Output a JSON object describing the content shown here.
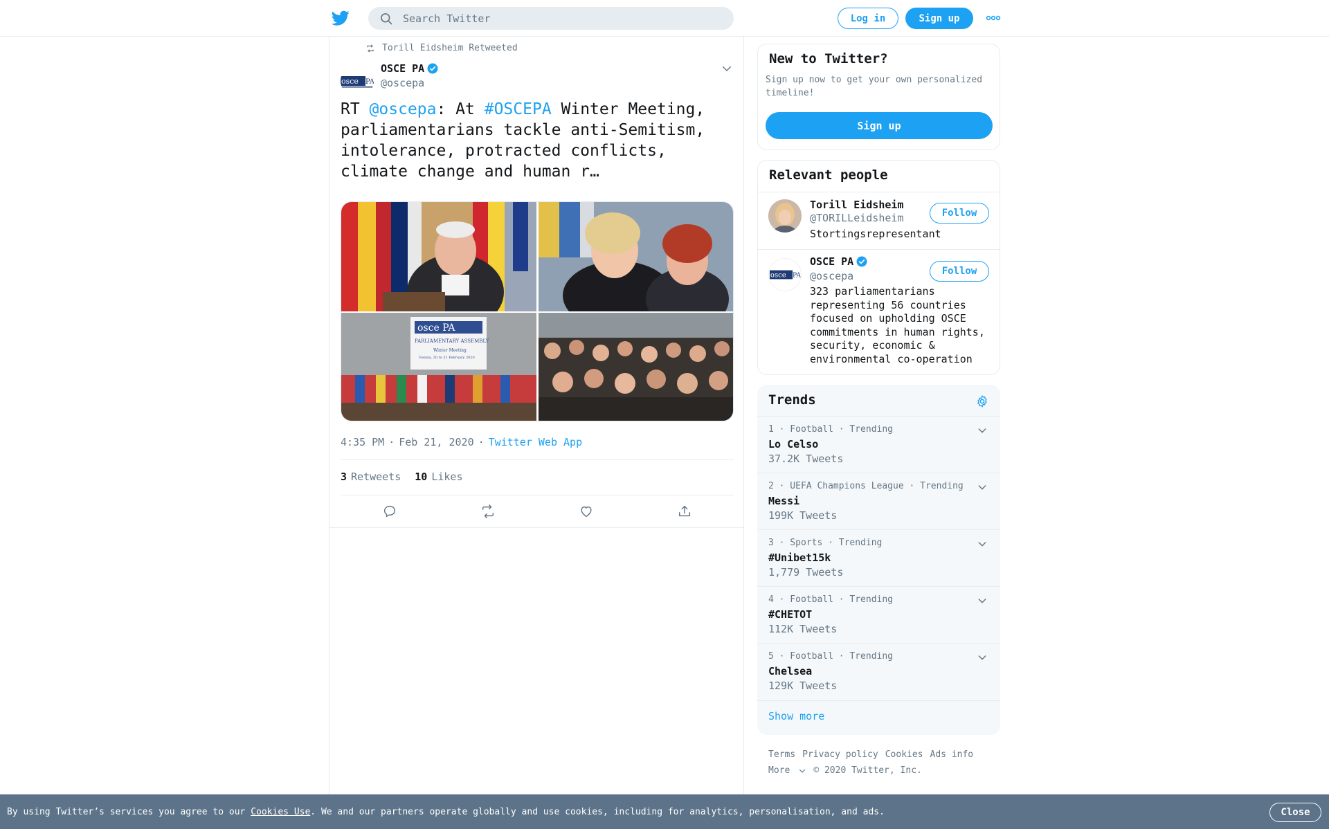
{
  "header": {
    "search_placeholder": "Search Twitter",
    "login_label": "Log in",
    "signup_label": "Sign up"
  },
  "tweet": {
    "retweeted_by": "Torill Eidsheim Retweeted",
    "author_name": "OSCE PA",
    "author_handle": "@oscepa",
    "text_prefix": "RT ",
    "mention": "@oscepa",
    "text_mid": ": At ",
    "hashtag": "#OSCEPA",
    "text_rest": " Winter Meeting, parliamentarians tackle anti-Semitism, intolerance, protracted conflicts, climate change and human r…",
    "time": "4:35 PM",
    "date": "Feb 21, 2020",
    "source": "Twitter Web App",
    "retweets_count": "3",
    "retweets_label": "Retweets",
    "likes_count": "10",
    "likes_label": "Likes",
    "media_text": {
      "banner_logo": "osce PA",
      "banner_title": "PARLIAMENTARY ASSEMBLY",
      "banner_line1": "Winter Meeting",
      "banner_line2": "Vienna, 20 to 21 February 2020"
    }
  },
  "new_to_twitter": {
    "title": "New to Twitter?",
    "subtitle": "Sign up now to get your own personalized timeline!",
    "button_label": "Sign up"
  },
  "relevant_people": {
    "title": "Relevant people",
    "people": [
      {
        "name": "Torill Eidsheim",
        "handle": "@TORILLeidsheim",
        "bio": "Stortingsrepresentant",
        "follow_label": "Follow"
      },
      {
        "name": "OSCE PA",
        "handle": "@oscepa",
        "bio": "323 parliamentarians representing 56 countries focused on upholding OSCE commitments in human rights, security, economic & environmental co-operation",
        "follow_label": "Follow"
      }
    ]
  },
  "trends": {
    "title": "Trends",
    "items": [
      {
        "meta": "1 · Football · Trending",
        "name": "Lo Celso",
        "count": "37.2K Tweets"
      },
      {
        "meta": "2 · UEFA Champions League · Trending",
        "name": "Messi",
        "count": "199K Tweets"
      },
      {
        "meta": "3 · Sports · Trending",
        "name": "#Unibet15k",
        "count": "1,779 Tweets"
      },
      {
        "meta": "4 · Football · Trending",
        "name": "#CHETOT",
        "count": "112K Tweets"
      },
      {
        "meta": "5 · Football · Trending",
        "name": "Chelsea",
        "count": "129K Tweets"
      }
    ],
    "show_more": "Show more"
  },
  "footer": {
    "terms": "Terms",
    "privacy": "Privacy policy",
    "cookies": "Cookies",
    "ads_info": "Ads info",
    "more": "More",
    "copyright": "© 2020 Twitter, Inc."
  },
  "cookie_bar": {
    "text_before": "By using Twitter’s services you agree to our ",
    "link": "Cookies Use",
    "text_after": ". We and our partners operate globally and use cookies, including for analytics, personalisation, and ads.",
    "close_label": "Close"
  },
  "colors": {
    "brand": "#1da1f2",
    "text": "#14171a",
    "secondary": "#657786",
    "cookie_bar": "#5d7389"
  },
  "icons": [
    "twitter-bird-icon",
    "search-icon",
    "more-dots-icon",
    "retweet-icon",
    "verified-badge-icon",
    "chevron-down-icon",
    "reply-icon",
    "like-icon",
    "share-icon",
    "gear-icon"
  ]
}
